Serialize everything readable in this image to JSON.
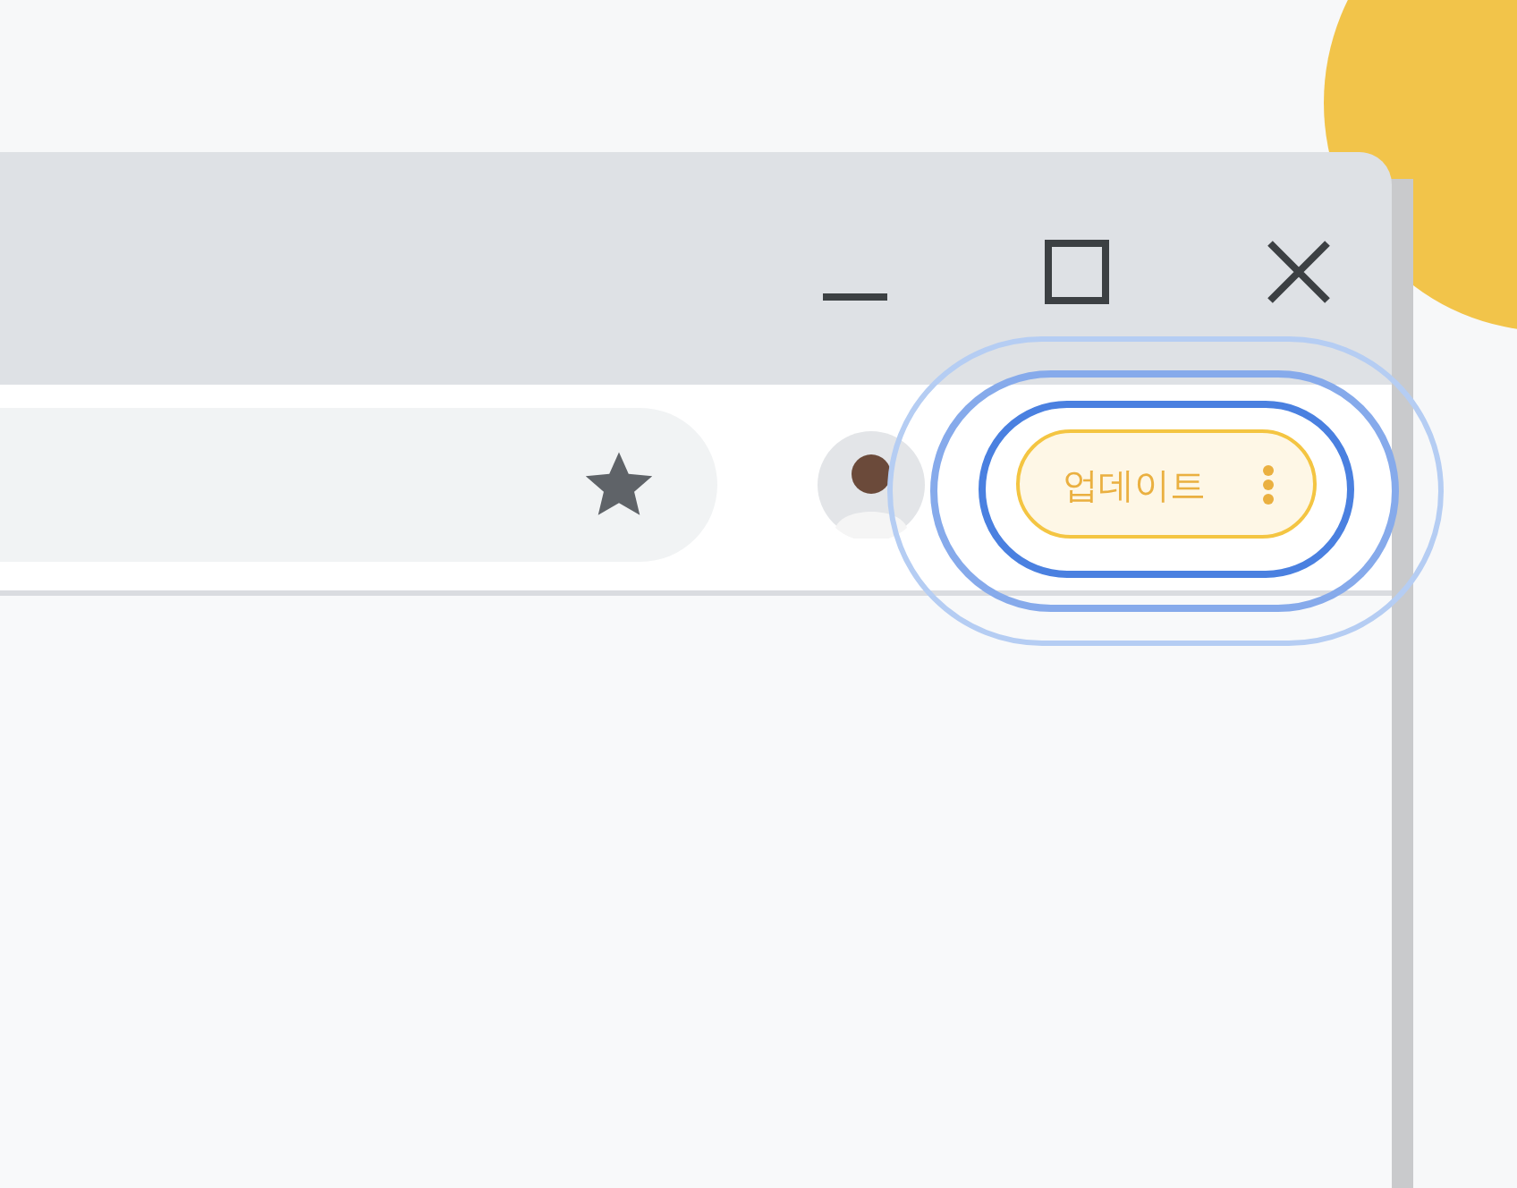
{
  "update_button": {
    "label": "업데이트"
  }
}
